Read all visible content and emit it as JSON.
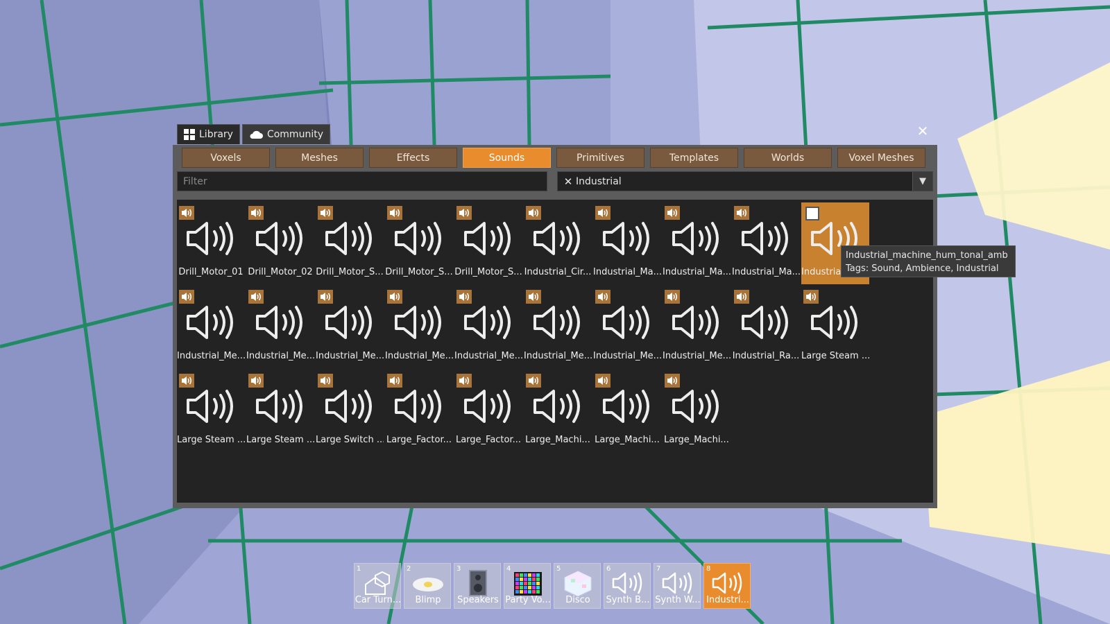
{
  "window": {
    "tabs": [
      {
        "label": "Library",
        "icon": "grid-icon"
      },
      {
        "label": "Community",
        "icon": "cloud-icon"
      }
    ],
    "close_glyph": "✕"
  },
  "categories": [
    "Voxels",
    "Meshes",
    "Effects",
    "Sounds",
    "Primitives",
    "Templates",
    "Worlds",
    "Voxel Meshes"
  ],
  "active_category": "Sounds",
  "filter": {
    "placeholder": "Filter",
    "value": ""
  },
  "tag_filter": {
    "clear_glyph": "✕",
    "value": "Industrial",
    "dropdown_glyph": "▼"
  },
  "items": [
    "Drill_Motor_01",
    "Drill_Motor_02",
    "Drill_Motor_S...",
    "Drill_Motor_S...",
    "Drill_Motor_S...",
    "Industrial_Cir...",
    "Industrial_Ma...",
    "Industrial_Ma...",
    "Industrial_Ma...",
    "Industrial_ma...",
    "Industrial_Me...",
    "Industrial_Me...",
    "Industrial_Me...",
    "Industrial_Me...",
    "Industrial_Me...",
    "Industrial_Me...",
    "Industrial_Me...",
    "Industrial_Me...",
    "Industrial_Ra...",
    "Large Steam ...",
    "Large Steam ...",
    "Large Steam ...",
    "Large Switch ...",
    "Large_Factor...",
    "Large_Factor...",
    "Large_Machi...",
    "Large_Machi...",
    "Large_Machi..."
  ],
  "selected_index": 9,
  "tooltip": {
    "name": "Industrial_machine_hum_tonal_amb",
    "tags": "Tags: Sound, Ambience, Industrial"
  },
  "hotbar": [
    {
      "num": "1",
      "name": "Car Turn...",
      "icon": "house-icon"
    },
    {
      "num": "2",
      "name": "Blimp",
      "icon": "blimp-icon"
    },
    {
      "num": "3",
      "name": "Speakers",
      "icon": "speaker-cabinet-icon"
    },
    {
      "num": "4",
      "name": "Party Vo...",
      "icon": "party-voxel-icon"
    },
    {
      "num": "5",
      "name": "Disco",
      "icon": "disco-cube-icon"
    },
    {
      "num": "6",
      "name": "Synth B...",
      "icon": "speaker-icon"
    },
    {
      "num": "7",
      "name": "Synth W...",
      "icon": "speaker-icon"
    },
    {
      "num": "8",
      "name": "Industri...",
      "icon": "speaker-icon"
    }
  ],
  "hotbar_active": 7,
  "colors": {
    "accent": "#e88c2e",
    "category_button": "#7a5a3e",
    "panel": "#232323"
  }
}
